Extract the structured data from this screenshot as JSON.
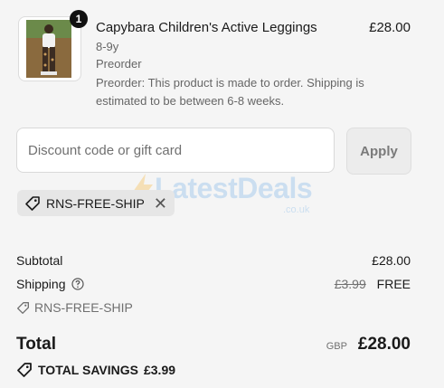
{
  "item": {
    "quantity": "1",
    "title": "Capybara Children's Active Leggings",
    "price": "£28.00",
    "variant": "8-9y",
    "status": "Preorder",
    "note": "Preorder: This product is made to order. Shipping is estimated to be between 6-8 weeks.",
    "thumbnail_icon": "product-photo-child-in-leggings"
  },
  "discount": {
    "placeholder": "Discount code or gift card",
    "apply_label": "Apply",
    "applied_code": "RNS-FREE-SHIP"
  },
  "watermark": {
    "text": "LatestDeals",
    "sub": ".co.uk"
  },
  "summary": {
    "subtotal_label": "Subtotal",
    "subtotal_value": "£28.00",
    "shipping_label": "Shipping",
    "shipping_original": "£3.99",
    "shipping_value": "FREE",
    "shipping_code": "RNS-FREE-SHIP",
    "total_label": "Total",
    "currency": "GBP",
    "total_value": "£28.00",
    "savings_label": "TOTAL SAVINGS",
    "savings_value": "£3.99"
  },
  "colors": {
    "background": "#f5f5f5",
    "badge": "#111111",
    "chip": "#e6e6e6",
    "watermark": "#7fb6e8"
  }
}
